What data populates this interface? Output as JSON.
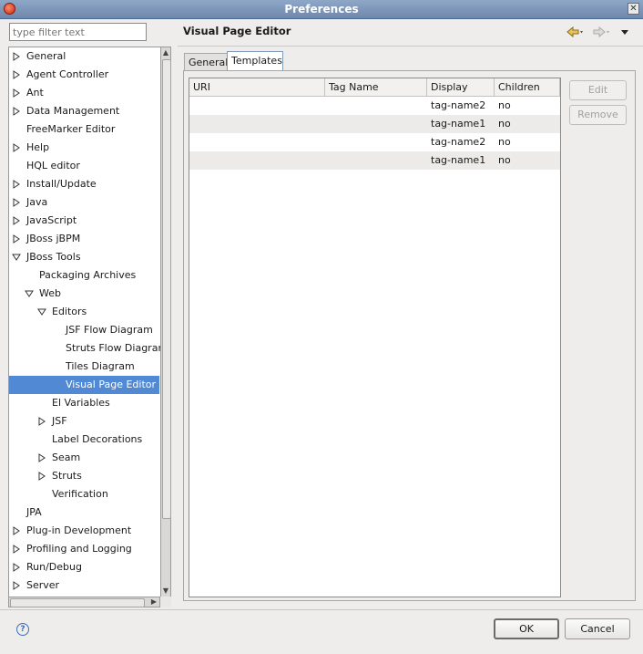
{
  "window": {
    "title": "Preferences"
  },
  "filter": {
    "placeholder": "type filter text"
  },
  "tree": [
    {
      "label": "General",
      "depth": 0,
      "toggle": "collapsed"
    },
    {
      "label": "Agent Controller",
      "depth": 0,
      "toggle": "collapsed"
    },
    {
      "label": "Ant",
      "depth": 0,
      "toggle": "collapsed"
    },
    {
      "label": "Data Management",
      "depth": 0,
      "toggle": "collapsed"
    },
    {
      "label": "FreeMarker Editor",
      "depth": 0,
      "toggle": "none"
    },
    {
      "label": "Help",
      "depth": 0,
      "toggle": "collapsed"
    },
    {
      "label": "HQL editor",
      "depth": 0,
      "toggle": "none"
    },
    {
      "label": "Install/Update",
      "depth": 0,
      "toggle": "collapsed"
    },
    {
      "label": "Java",
      "depth": 0,
      "toggle": "collapsed"
    },
    {
      "label": "JavaScript",
      "depth": 0,
      "toggle": "collapsed"
    },
    {
      "label": "JBoss jBPM",
      "depth": 0,
      "toggle": "collapsed"
    },
    {
      "label": "JBoss Tools",
      "depth": 0,
      "toggle": "expanded"
    },
    {
      "label": "Packaging Archives",
      "depth": 1,
      "toggle": "none"
    },
    {
      "label": "Web",
      "depth": 1,
      "toggle": "expanded"
    },
    {
      "label": "Editors",
      "depth": 2,
      "toggle": "expanded"
    },
    {
      "label": "JSF Flow Diagram",
      "depth": 3,
      "toggle": "none"
    },
    {
      "label": "Struts Flow Diagram",
      "depth": 3,
      "toggle": "none"
    },
    {
      "label": "Tiles Diagram",
      "depth": 3,
      "toggle": "none"
    },
    {
      "label": "Visual Page Editor",
      "depth": 3,
      "toggle": "none",
      "selected": true
    },
    {
      "label": "El Variables",
      "depth": 2,
      "toggle": "none"
    },
    {
      "label": "JSF",
      "depth": 2,
      "toggle": "collapsed"
    },
    {
      "label": "Label Decorations",
      "depth": 2,
      "toggle": "none"
    },
    {
      "label": "Seam",
      "depth": 2,
      "toggle": "collapsed"
    },
    {
      "label": "Struts",
      "depth": 2,
      "toggle": "collapsed"
    },
    {
      "label": "Verification",
      "depth": 2,
      "toggle": "none"
    },
    {
      "label": "JPA",
      "depth": 0,
      "toggle": "none"
    },
    {
      "label": "Plug-in Development",
      "depth": 0,
      "toggle": "collapsed"
    },
    {
      "label": "Profiling and Logging",
      "depth": 0,
      "toggle": "collapsed"
    },
    {
      "label": "Run/Debug",
      "depth": 0,
      "toggle": "collapsed"
    },
    {
      "label": "Server",
      "depth": 0,
      "toggle": "collapsed"
    }
  ],
  "page": {
    "title": "Visual Page Editor",
    "nav": {
      "back_icon": "back-arrow-icon",
      "forward_icon": "forward-arrow-icon",
      "menu_icon": "view-menu-icon"
    }
  },
  "tabs": [
    {
      "label": "General",
      "active": false
    },
    {
      "label": "Templates",
      "active": true
    }
  ],
  "table": {
    "columns": [
      "URI",
      "Tag Name",
      "Display",
      "Children"
    ],
    "rows": [
      [
        "",
        "",
        "tag-name2",
        "no"
      ],
      [
        "",
        "",
        "tag-name1",
        "no"
      ],
      [
        "",
        "",
        "tag-name2",
        "no"
      ],
      [
        "",
        "",
        "tag-name1",
        "no"
      ]
    ]
  },
  "side_buttons": {
    "edit": "Edit",
    "remove": "Remove"
  },
  "footer": {
    "ok": "OK",
    "cancel": "Cancel",
    "help_icon": "help-icon"
  },
  "colors": {
    "selection": "#5289d4",
    "title_bar": "#7d96bb"
  }
}
